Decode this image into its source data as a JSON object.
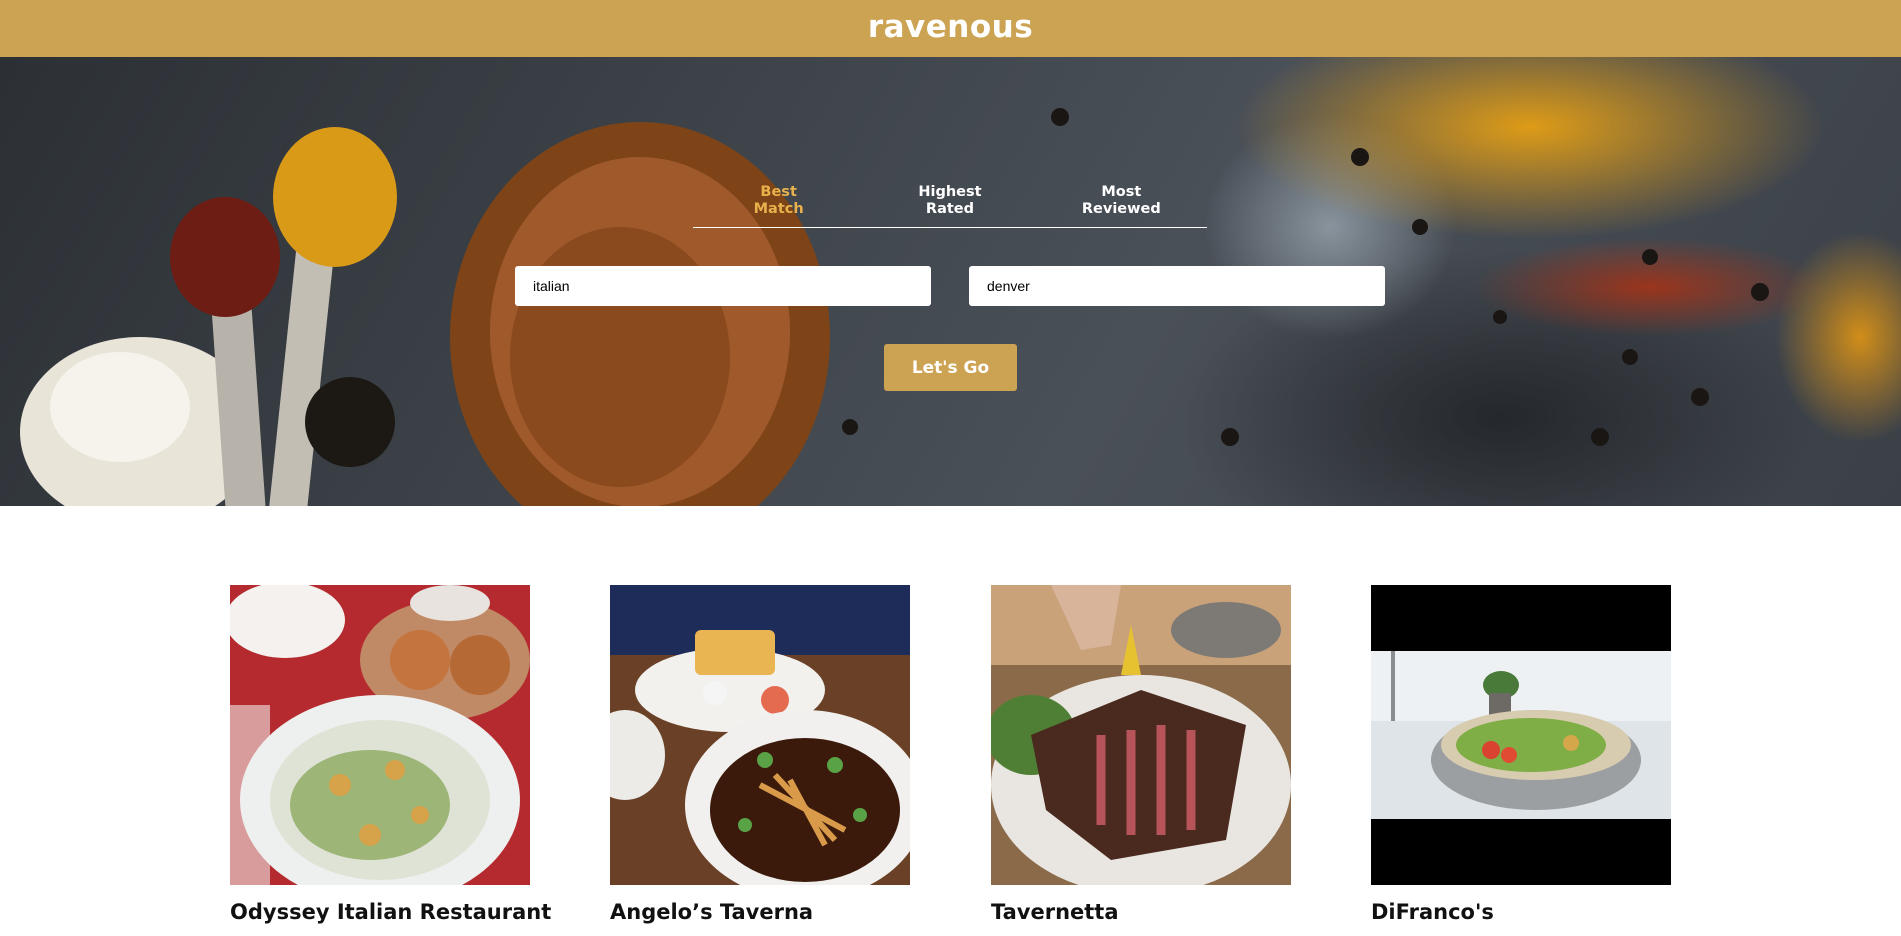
{
  "header": {
    "logo": "ravenous"
  },
  "search": {
    "sort_tabs": [
      {
        "label": "Best\nMatch",
        "active": true
      },
      {
        "label": "Highest\nRated",
        "active": false
      },
      {
        "label": "Most\nReviewed",
        "active": false
      }
    ],
    "term_value": "italian",
    "location_value": "denver",
    "submit_label": "Let's Go"
  },
  "results": [
    {
      "name": "Odyssey Italian Restaurant"
    },
    {
      "name": "Angelo’s Taverna"
    },
    {
      "name": "Tavernetta"
    },
    {
      "name": "DiFranco's"
    }
  ],
  "colors": {
    "brand": "#cca353",
    "active_tab": "#e8b14c"
  }
}
